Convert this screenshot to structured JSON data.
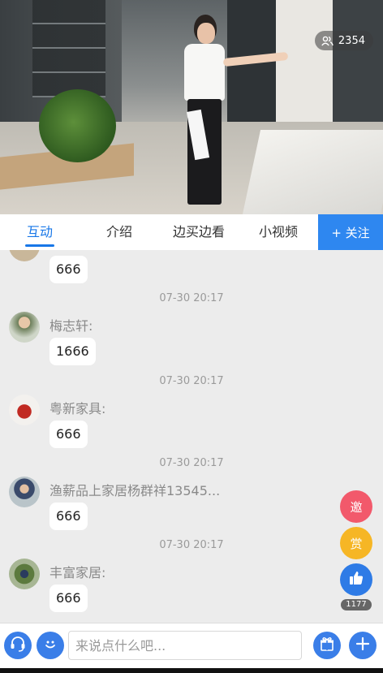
{
  "stream": {
    "viewer_count": "2354",
    "viewer_icon": "people-icon"
  },
  "tabs": [
    {
      "label": "互动",
      "active": true
    },
    {
      "label": "介绍"
    },
    {
      "label": "边买边看"
    },
    {
      "label": "小视频"
    }
  ],
  "follow_label": "+ 关注",
  "messages": [
    {
      "timestamp": "",
      "username": "",
      "text": "666"
    },
    {
      "timestamp": "07-30 20:17",
      "username": "梅志轩:",
      "text": "1666"
    },
    {
      "timestamp": "07-30 20:17",
      "username": "粤新家具:",
      "text": "666"
    },
    {
      "timestamp": "07-30 20:17",
      "username": "渔薪品上家居杨群祥13545...",
      "text": "666"
    },
    {
      "timestamp": "07-30 20:17",
      "username": "丰富家居:",
      "text": "666"
    }
  ],
  "floating": {
    "invite_label": "邀",
    "reward_label": "赏",
    "like_count": "1177"
  },
  "bottom_bar": {
    "input_placeholder": "来说点什么吧...",
    "icons": [
      "headset-icon",
      "emoji-icon",
      "gift-icon",
      "plus-icon"
    ]
  },
  "colors": {
    "accent": "#1877e8",
    "follow_bg": "#2e87f0",
    "invite": "#f2596b",
    "reward": "#f6b625",
    "like": "#2e7be6"
  }
}
